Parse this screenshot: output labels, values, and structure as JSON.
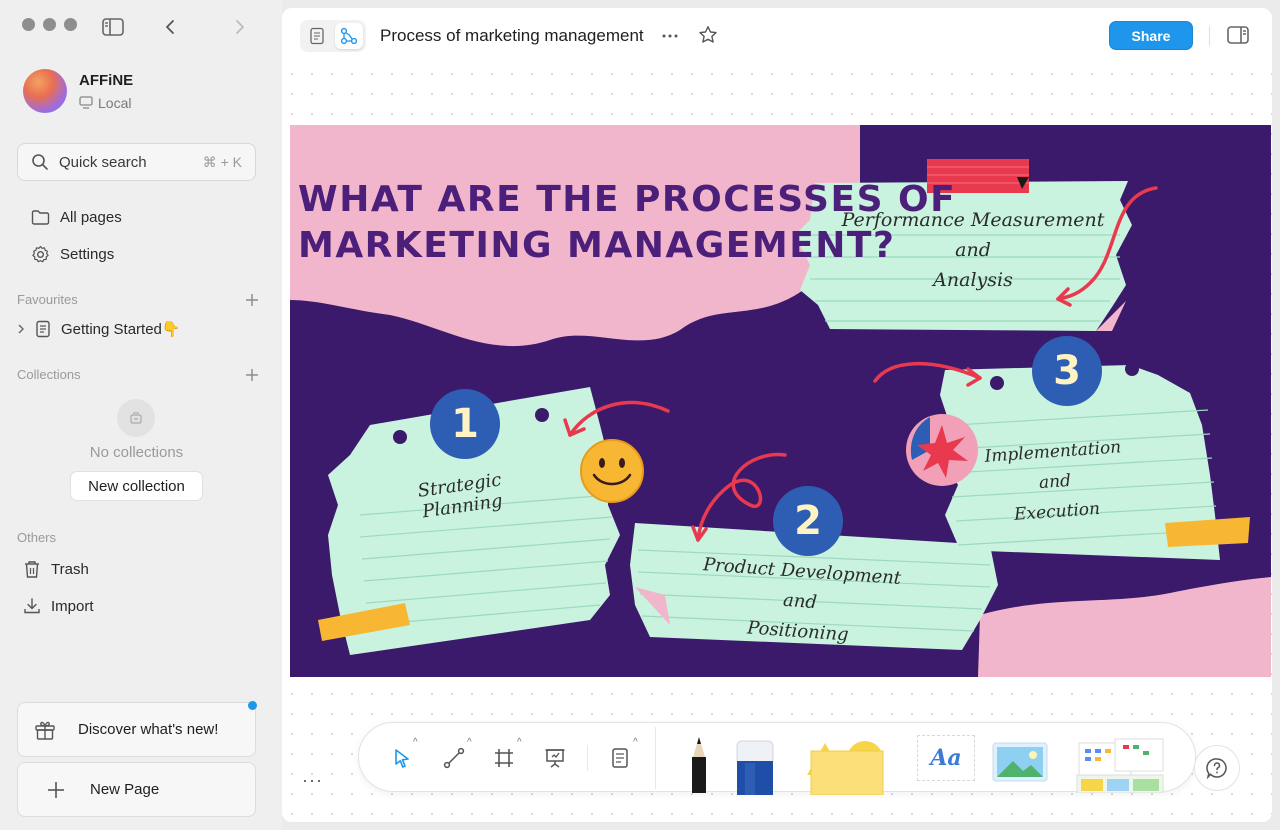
{
  "workspace": {
    "name": "AFFiNE",
    "storage": "Local"
  },
  "search": {
    "label": "Quick search",
    "shortcut": "⌘ + K"
  },
  "nav": {
    "all_pages": "All pages",
    "settings": "Settings"
  },
  "favourites": {
    "label": "Favourites",
    "items": [
      {
        "label": "Getting Started👇"
      }
    ]
  },
  "collections": {
    "label": "Collections",
    "empty_text": "No collections",
    "new_button": "New collection"
  },
  "others": {
    "label": "Others",
    "trash": "Trash",
    "import": "Import"
  },
  "discover": {
    "label": "Discover what's new!"
  },
  "new_page": {
    "label": "New Page"
  },
  "header": {
    "title": "Process of marketing management",
    "share_label": "Share"
  },
  "infographic": {
    "title_line1": "WHAT ARE THE PROCESSES OF",
    "title_line2": "MARKETING MANAGEMENT?",
    "steps": [
      {
        "number": "1",
        "label": "Strategic Planning"
      },
      {
        "number": "2",
        "label_line1": "Product Development and",
        "label_line2": "Positioning"
      },
      {
        "number": "3",
        "label_line1": "Implementation and",
        "label_line2": "Execution"
      }
    ],
    "top_note_line1": "Performance Measurement and",
    "top_note_line2": "Analysis"
  },
  "toolbar": {
    "text_tool_label": "Aa",
    "more_label": "···"
  },
  "colors": {
    "accent": "#1e96eb",
    "slide_bg": "#3b1a6b",
    "pink": "#f2b6cc",
    "note": "#c9f3df",
    "tape": "#f7b733",
    "number_bg": "#2d5eb3",
    "arrow": "#e8394f"
  }
}
